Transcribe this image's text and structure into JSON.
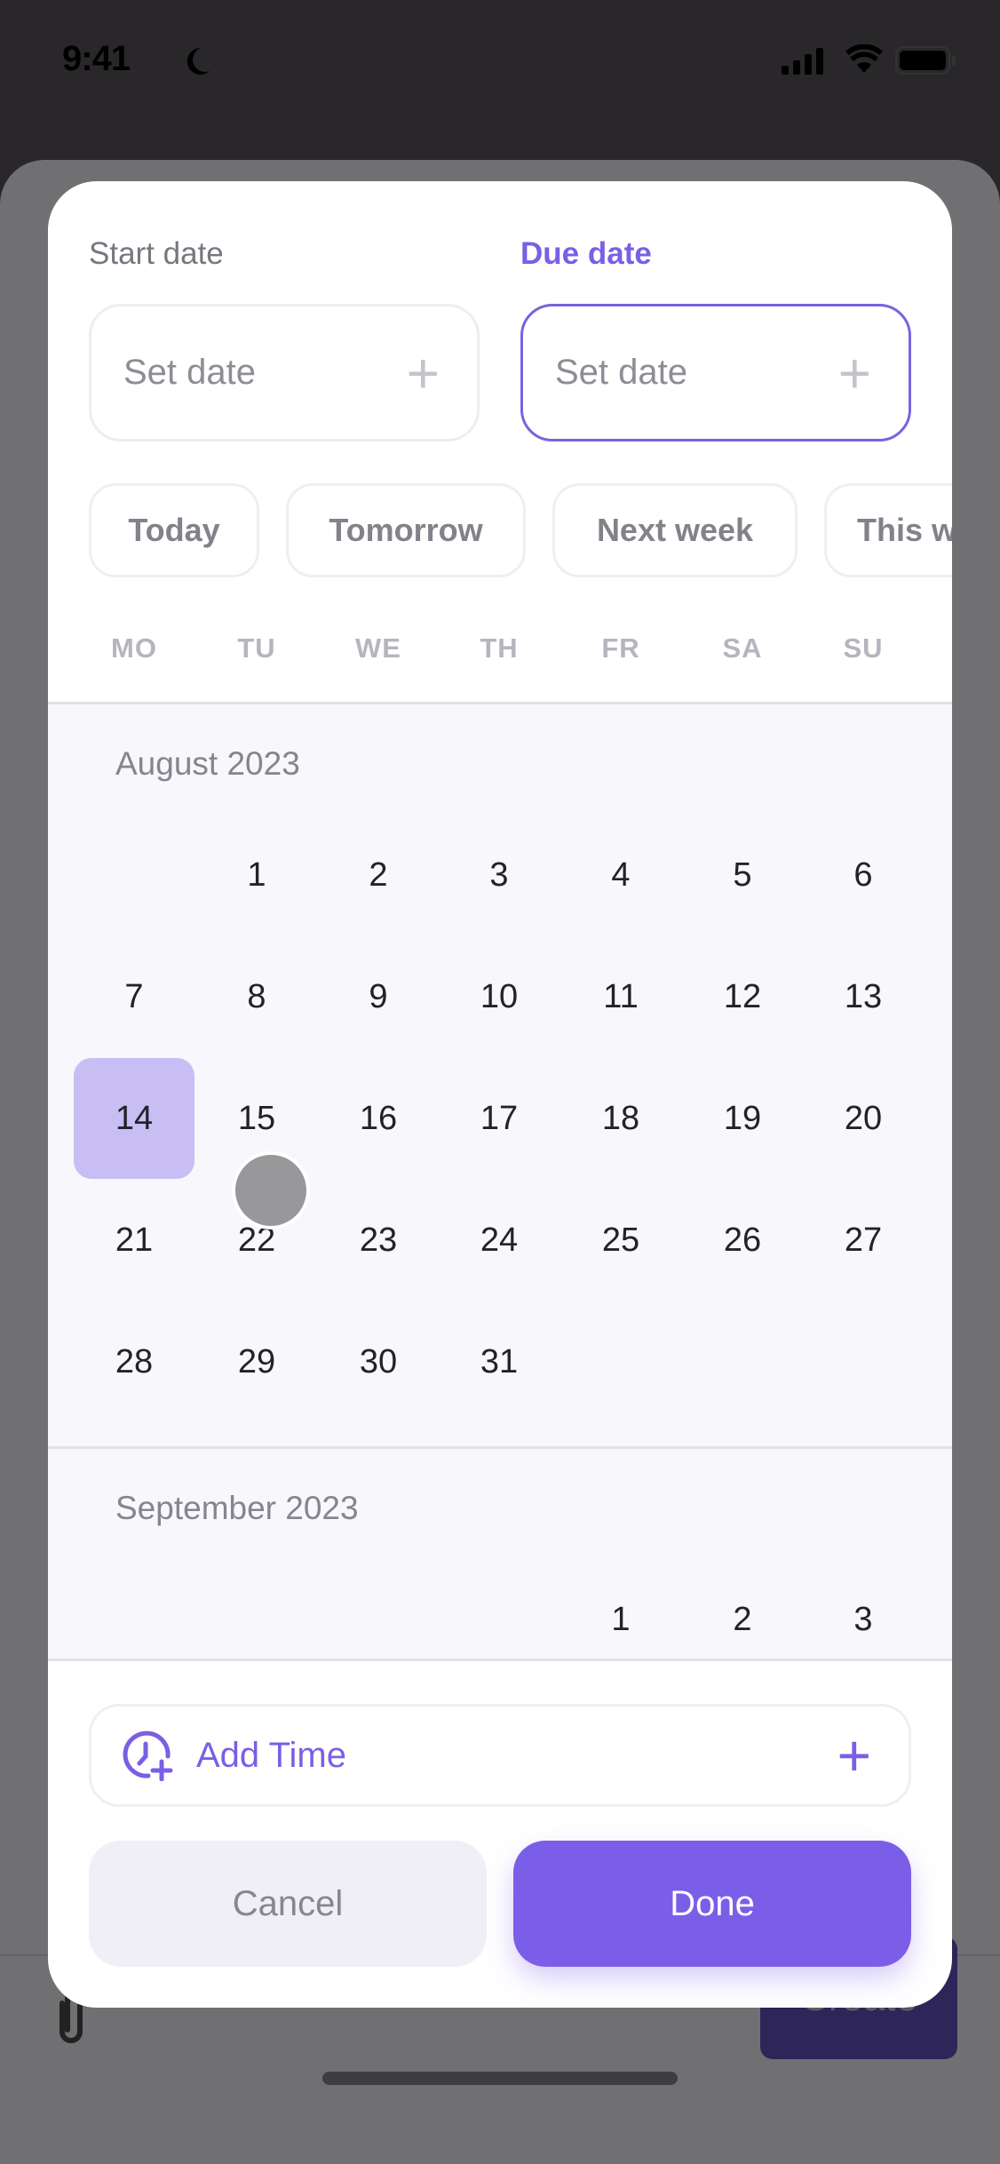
{
  "status": {
    "time": "9:41"
  },
  "background": {
    "create_label": "Create"
  },
  "picker": {
    "start_label": "Start date",
    "due_label": "Due date",
    "start_placeholder": "Set date",
    "due_placeholder": "Set date",
    "chips": [
      "Today",
      "Tomorrow",
      "Next week",
      "This week"
    ],
    "weekdays": [
      "MO",
      "TU",
      "WE",
      "TH",
      "FR",
      "SA",
      "SU"
    ],
    "months": [
      {
        "title": "August 2023",
        "first_weekday_index": 1,
        "days": 31
      },
      {
        "title": "September 2023",
        "first_weekday_index": 4,
        "days": 3
      }
    ],
    "selected_day": 14,
    "add_time_label": "Add Time",
    "cancel_label": "Cancel",
    "done_label": "Done",
    "accent": "#7b5ee8",
    "selected_color": "#c8bef4"
  }
}
